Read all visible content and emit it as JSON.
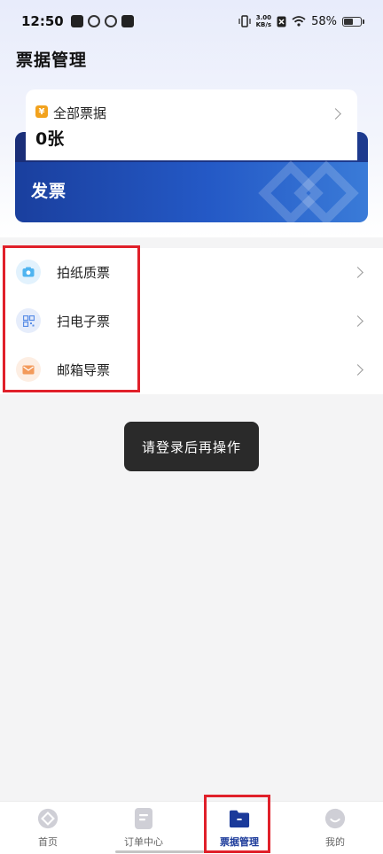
{
  "status_bar": {
    "time": "12:50",
    "speed_value": "3.00",
    "speed_unit": "KB/s",
    "battery": "58%",
    "battery_level": 0.58
  },
  "page": {
    "title": "票据管理"
  },
  "summary": {
    "all_label": "全部票据",
    "yuan_symbol": "¥",
    "count": "0张",
    "invoice_label": "发票"
  },
  "menu": {
    "items": [
      {
        "label": "拍纸质票",
        "icon": "camera-icon",
        "color": "#4fb4f0"
      },
      {
        "label": "扫电子票",
        "icon": "qr-code-icon",
        "color": "#5a8ee6"
      },
      {
        "label": "邮箱导票",
        "icon": "mail-icon",
        "color": "#f39a5b"
      }
    ]
  },
  "toast": {
    "message": "请登录后再操作"
  },
  "bottom_nav": {
    "items": [
      {
        "label": "首页",
        "icon": "home-icon"
      },
      {
        "label": "订单中心",
        "icon": "order-icon"
      },
      {
        "label": "票据管理",
        "icon": "folder-icon"
      },
      {
        "label": "我的",
        "icon": "profile-icon"
      }
    ],
    "active_index": 2
  },
  "colors": {
    "brand": "#1b3a9a",
    "highlight": "#e0202a",
    "accent_gold": "#f2a21d"
  }
}
